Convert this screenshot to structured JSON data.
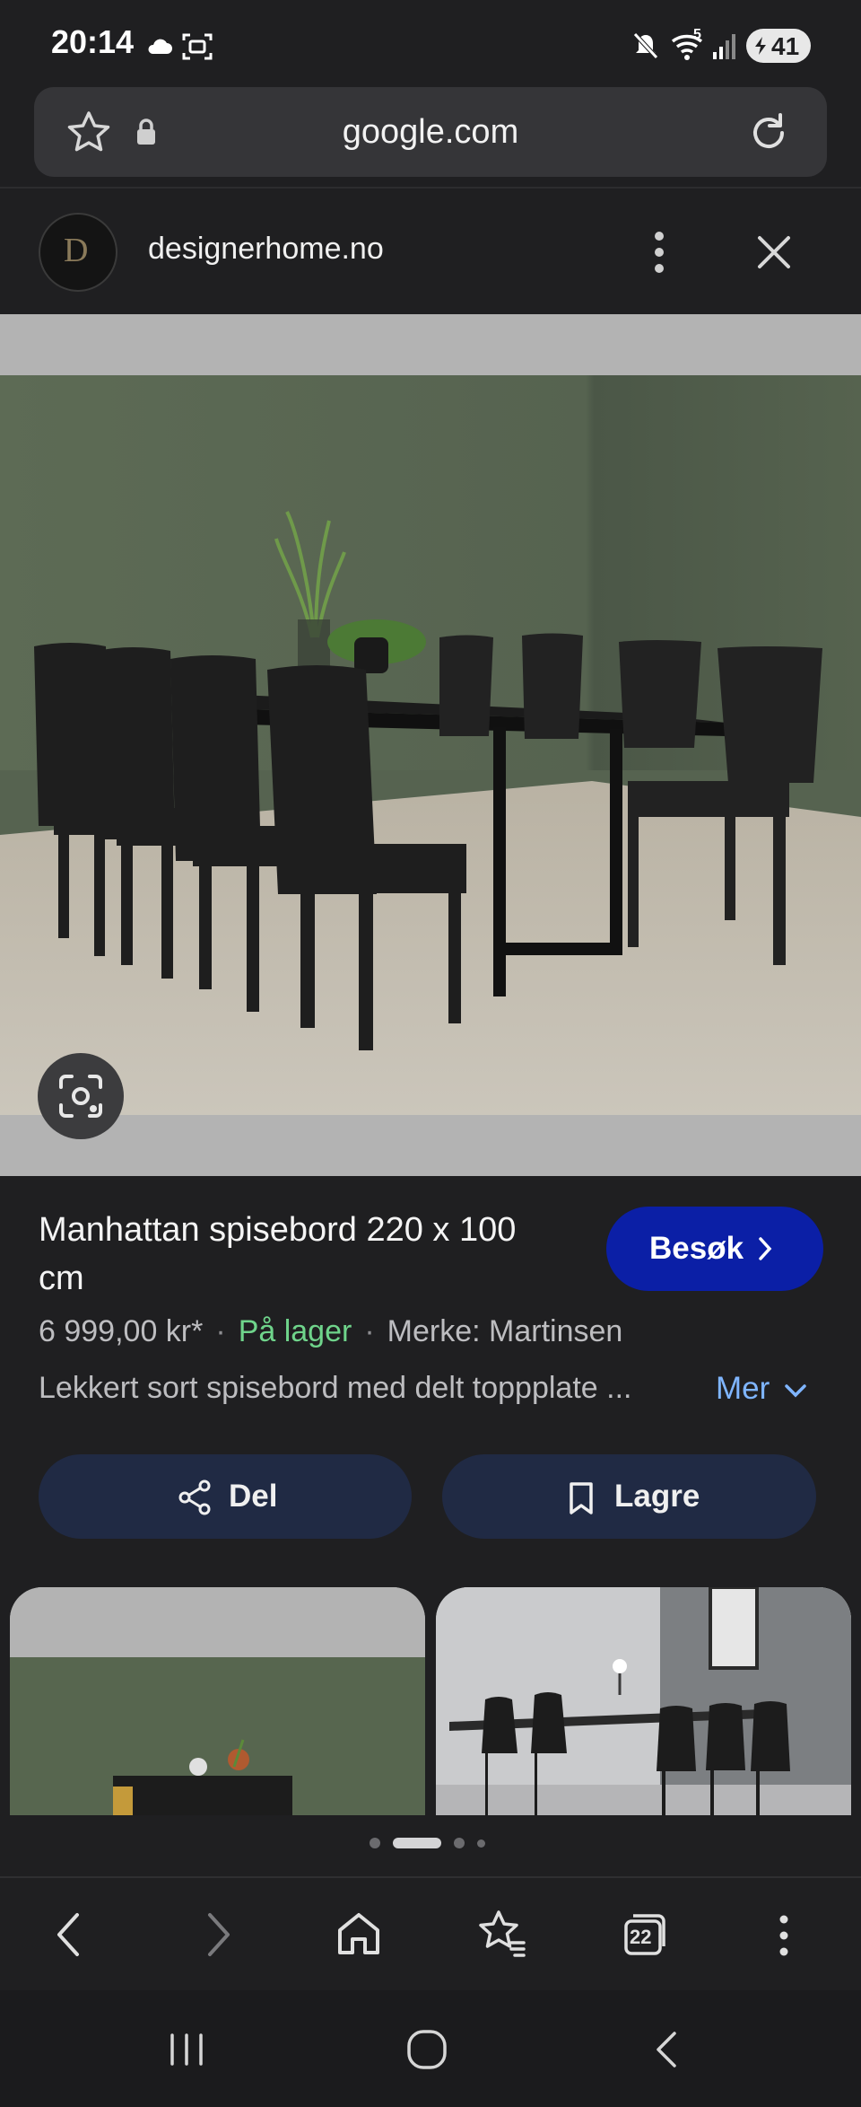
{
  "status_bar": {
    "time": "20:14",
    "battery": "41",
    "signal_label": "5"
  },
  "browser": {
    "url": "google.com"
  },
  "site": {
    "name": "designerhome.no",
    "logo_text": "D"
  },
  "product": {
    "title": "Manhattan spisebord 220 x 100 cm",
    "visit_label": "Besøk",
    "price": "6 999,00 kr*",
    "stock": "På lager",
    "brand": "Merke: Martinsen",
    "description": "Lekkert sort spisebord med delt toppplate ...",
    "more_label": "Mer",
    "share_label": "Del",
    "save_label": "Lagre"
  },
  "bottom_nav": {
    "tab_count": "22"
  },
  "colors": {
    "background": "#1f1f21",
    "accent_button": "#0b1fa6",
    "stock_green": "#6fd48b",
    "link_blue": "#7fb5ff",
    "pill_button": "#202a44"
  },
  "icons": [
    "cloud-icon",
    "screenshot-icon",
    "mute-icon",
    "wifi-icon",
    "signal-icon",
    "battery-icon",
    "star-icon",
    "lock-icon",
    "reload-icon",
    "more-vert-icon",
    "close-icon",
    "lens-icon",
    "chevron-right-icon",
    "chevron-down-icon",
    "share-icon",
    "bookmark-icon",
    "back-icon",
    "forward-icon",
    "home-icon",
    "bookmarks-icon",
    "tabs-icon",
    "menu-icon",
    "recents-icon",
    "home-circle-icon",
    "system-back-icon"
  ]
}
